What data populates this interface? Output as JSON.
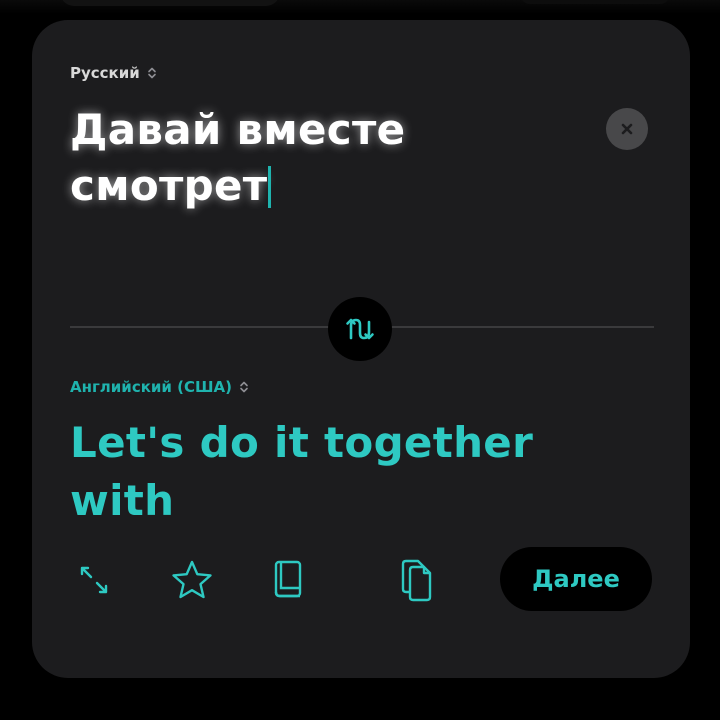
{
  "source": {
    "language": "Русский",
    "text": "Давай вместе смотрет"
  },
  "target": {
    "language": "Английский (США)",
    "text": "Let's do it together with"
  },
  "toolbar": {
    "next_label": "Далее"
  },
  "icons": {
    "language_picker": "chevron-up-down-icon",
    "clear": "close-icon",
    "swap": "swap-arrows-icon",
    "expand": "expand-icon",
    "favorite": "star-icon",
    "dictionary": "book-icon",
    "copy": "copy-icon"
  },
  "colors": {
    "accent": "#2ec9c2",
    "card": "#1c1c1e",
    "background": "#000000",
    "source_text": "#ffffff"
  }
}
